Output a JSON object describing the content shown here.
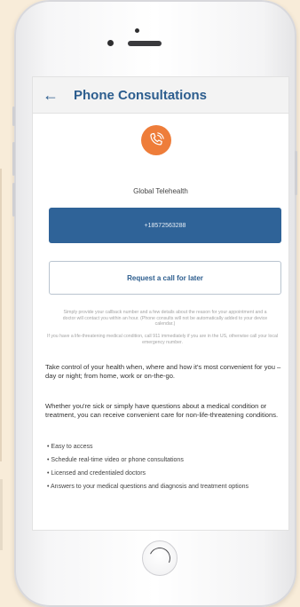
{
  "app": {
    "title": "Phone Consultations",
    "back_icon": "arrow-left-icon",
    "accent": "#2f6398",
    "logo_color": "#ee7d3a"
  },
  "provider": {
    "name": "Global Telehealth",
    "logo_icon": "phone-call-icon"
  },
  "buttons": {
    "phone_number": "+18572563288",
    "request_call": "Request a call for later"
  },
  "notices": {
    "callback": "Simply provide your callback number and a few details about the reason for your appointment and a doctor will contact you within an hour. (Phone consults will not be automatically added to your device calendar.)",
    "emergency": "If you have a life-threatening medical condition, call 911 immediately if you are in the US, otherwise call your local emergency number."
  },
  "content": {
    "paragraph1": "Take control of your health when, where and how it's most convenient for you – day or night; from home, work or on-the-go.",
    "paragraph2": "Whether you're sick or simply have questions about a medical condition or treatment, you can receive convenient care for non-life-threatening conditions.",
    "bullets": [
      "Easy to access",
      "Schedule real-time video or phone consultations",
      "Licensed and credentialed doctors",
      "Answers to your medical questions and diagnosis and treatment options"
    ]
  }
}
